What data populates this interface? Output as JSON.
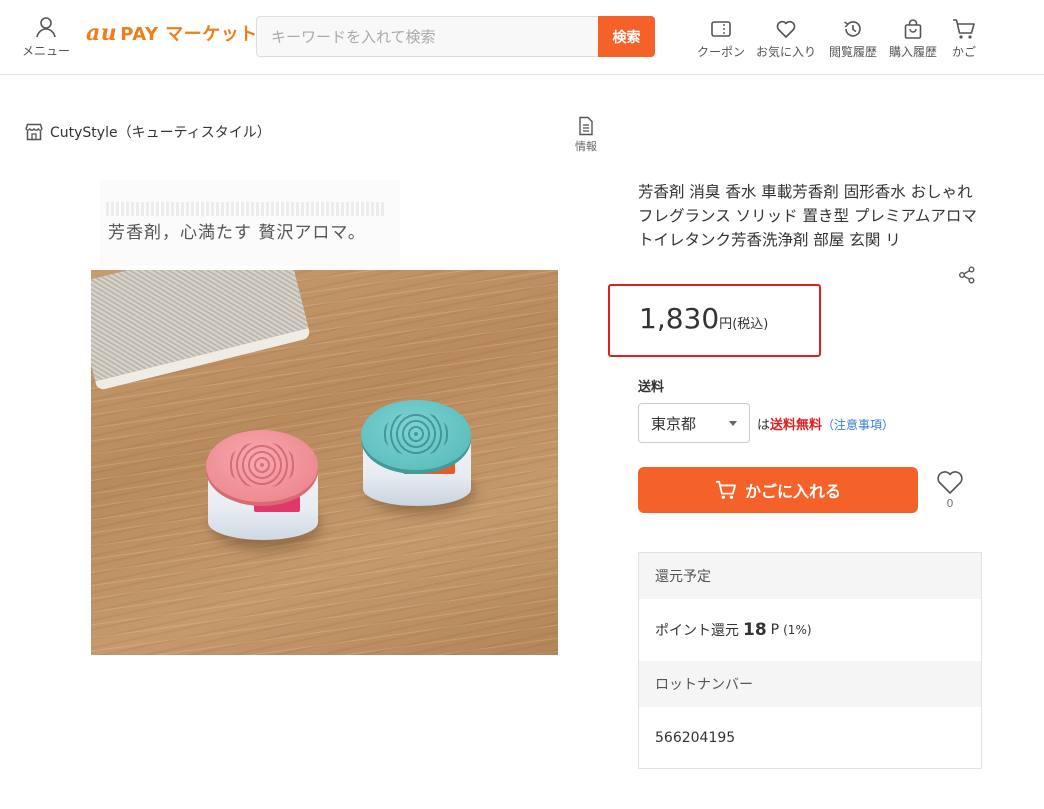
{
  "header": {
    "menu_label": "メニュー",
    "logo_au": "au",
    "logo_text": "PAY マーケット",
    "search_placeholder": "キーワードを入れて検索",
    "search_button": "検索",
    "nav": [
      {
        "label": "クーポン",
        "icon": "coupon-icon"
      },
      {
        "label": "お気に入り",
        "icon": "heart-icon"
      },
      {
        "label": "閲覧履歴",
        "icon": "history-icon"
      },
      {
        "label": "購入履歴",
        "icon": "bag-icon"
      },
      {
        "label": "かご",
        "icon": "cart-icon"
      }
    ]
  },
  "shop": {
    "name": "CutyStyle（キューティスタイル）",
    "info_label": "情報"
  },
  "image": {
    "tagline": "芳香剤，心満たす 贅沢アロマ。"
  },
  "product": {
    "title": "芳香剤 消臭 香水 車載芳香剤 固形香水 おしゃれ フレグランス ソリッド 置き型 プレミアムアロマ トイレタンク芳香洗浄剤 部屋 玄関 リ",
    "price": "1,830",
    "price_unit": "円",
    "price_tax": "(税込)"
  },
  "shipping": {
    "label": "送料",
    "prefecture": "東京都",
    "prefix": "は",
    "free": "送料無料",
    "note": "（注意事項）"
  },
  "cart": {
    "button_label": "かごに入れる",
    "favorite_count": "0"
  },
  "details": {
    "points_header": "還元予定",
    "points_prefix": "ポイント還元",
    "points_value": "18",
    "points_unit": "P",
    "points_rate": "(1%)",
    "lot_header": "ロットナンバー",
    "lot_value": "566204195"
  },
  "colors": {
    "accent": "#f4622a",
    "brand": "#ef7d1b",
    "highlight_border": "#e02020"
  }
}
